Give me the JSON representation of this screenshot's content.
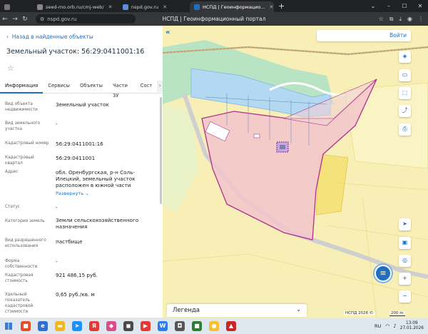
{
  "browser": {
    "tabs": [
      {
        "label": "seed-mo.orb.ru/cmj-web/",
        "color": "#4a4a4a",
        "active": false
      },
      {
        "label": "nspd.gov.ru",
        "color": "#5b8fd6",
        "active": false
      },
      {
        "label": "НСПД | Геоинформацио...",
        "color": "#1f6fc1",
        "active": true
      }
    ],
    "new_tab": "+",
    "url": "nspd.gov.ru",
    "page_title": "НСПД | Геоинформационный портал"
  },
  "panel": {
    "back_link": "Назад в найденные объекты",
    "title": "Земельный участок: 56:29:0411001:16",
    "tabs": [
      "Информация",
      "Сервисы",
      "Объекты",
      "Части ЗУ",
      "Сост"
    ],
    "attributes": [
      {
        "label": "Вид объекта недвижимости",
        "value": "Земельный участок"
      },
      {
        "label": "Вид земельного участка",
        "value": "-"
      },
      {
        "label": "Кадастровый номер",
        "value": "56:29:0411001:16"
      },
      {
        "label": "Кадастровый квартал",
        "value": "56:29:0411001"
      },
      {
        "label": "Адрес",
        "value": "обл. Оренбургская, р-н Соль-Илецкий, земельный участок расположен в южной части"
      },
      {
        "label": "Статус",
        "value": "-"
      },
      {
        "label": "Категория земель",
        "value": "Земли сельскохозяйственного назначения"
      },
      {
        "label": "Вид разрешенного использования",
        "value": "пастбище"
      },
      {
        "label": "Форма собственности",
        "value": "-"
      },
      {
        "label": "Кадастровая стоимость",
        "value": "921 486,15 руб."
      },
      {
        "label": "Удельный показатель кадастровой стоимости",
        "value": "0,65 руб./кв. м"
      }
    ],
    "expand_label": "Развернуть"
  },
  "map": {
    "login": "Войти",
    "legend": "Легенда",
    "copyright": "НСПД 2026 ©",
    "scale": "200 m",
    "colors": {
      "background": "#f8efb6",
      "parcel": "#f2c6cc",
      "parcel_border": "#b0308a",
      "water": "#b3d8f2",
      "forest": "#b9e4c4",
      "accent": "#1f6fc1"
    }
  },
  "taskbar": {
    "lang": "RU",
    "time": "13:09",
    "date": "27.01.2026"
  }
}
